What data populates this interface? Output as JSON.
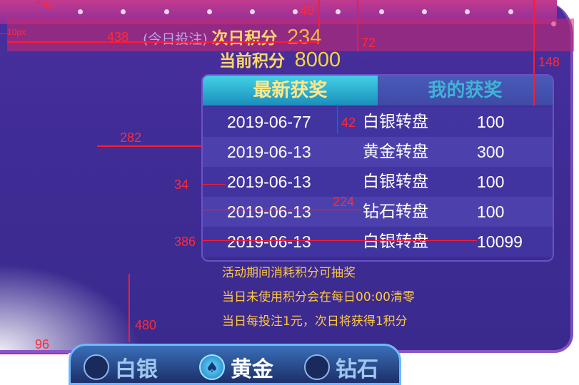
{
  "header": {
    "next_day_note": "(今日投注)",
    "next_day_label": "次日积分",
    "next_day_value": "234",
    "current_label": "当前积分",
    "current_value": "8000"
  },
  "tabs": [
    {
      "label": "最新获奖",
      "active": true
    },
    {
      "label": "我的获奖",
      "active": false
    }
  ],
  "records": [
    {
      "date": "2019-06-77",
      "wheel": "白银转盘",
      "amount": "100"
    },
    {
      "date": "2019-06-13",
      "wheel": "黄金转盘",
      "amount": "300"
    },
    {
      "date": "2019-06-13",
      "wheel": "白银转盘",
      "amount": "100"
    },
    {
      "date": "2019-06-13",
      "wheel": "钻石转盘",
      "amount": "100"
    },
    {
      "date": "2019-06-13",
      "wheel": "白银转盘",
      "amount": "10099"
    }
  ],
  "rules": [
    "活动期间消耗积分可抽奖",
    "当日未使用积分会在每日00:00清零",
    "当日每投注1元，次日将获得1积分"
  ],
  "nav": [
    {
      "label": "白银",
      "active": false
    },
    {
      "label": "黄金",
      "active": true
    },
    {
      "label": "钻石",
      "active": false
    }
  ],
  "annotations": [
    "6px",
    "10px",
    "40",
    "438",
    "72",
    "148",
    "282",
    "42",
    "34",
    "224",
    "386",
    "480",
    "96"
  ],
  "colors": {
    "accent_gold": "#ffd66a",
    "tab_active": "#2fb8d8",
    "panel": "#3f2c95",
    "guide": "#ff1a2e"
  }
}
